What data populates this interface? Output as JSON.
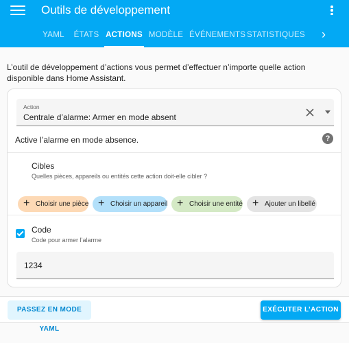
{
  "header": {
    "title": "Outils de développement",
    "tabs": [
      {
        "label": "YAML"
      },
      {
        "label": "ÉTATS"
      },
      {
        "label": "ACTIONS"
      },
      {
        "label": "MODÈLE"
      },
      {
        "label": "ÉVÉNEMENTS"
      },
      {
        "label": "STATISTIQUES"
      }
    ],
    "active_tab": "ACTIONS",
    "next_icon": "chevron-right-icon",
    "menu_icon": "menu-icon",
    "more_icon": "dots-vertical-icon"
  },
  "intro": "L’outil de développement d’actions vous permet d’effectuer n’importe quelle action disponible dans Home Assistant.",
  "action_field": {
    "label": "Action",
    "value": "Centrale d’alarme: Armer en mode absent",
    "clear_icon": "close-icon",
    "dropdown_icon": "menu-down-icon"
  },
  "description": "Active l’alarme en mode absence.",
  "help_icon": "help-circle-icon",
  "targets": {
    "title": "Cibles",
    "subtitle": "Quelles pièces, appareils ou entités cette action doit-elle cibler ?",
    "chips": [
      {
        "label": "Choisir une pièce",
        "color": "#fdd9b5"
      },
      {
        "label": "Choisir un appareil",
        "color": "#b3e0fa"
      },
      {
        "label": "Choisir une entité",
        "color": "#d4e9c5"
      },
      {
        "label": "Ajouter un libellé",
        "color": "#e4e4e4"
      }
    ]
  },
  "code": {
    "checked": true,
    "label": "Code",
    "helper": "Code pour armer l’alarme",
    "value": "1234"
  },
  "footer": {
    "yaml_button": "PASSEZ EN MODE YAML",
    "run_button": "EXÉCUTER L’ACTION"
  },
  "colors": {
    "primary": "#03a9f4",
    "background": "#fafafa"
  }
}
